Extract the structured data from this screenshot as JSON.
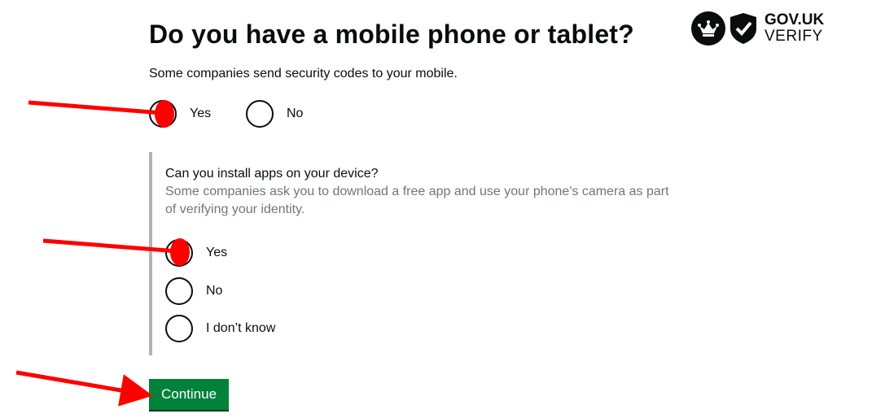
{
  "header": {
    "title": "Do you have a mobile phone or tablet?",
    "logo": {
      "brand": "GOV.UK",
      "product": "VERIFY",
      "icons": [
        "crown-icon",
        "shield-check-icon"
      ]
    }
  },
  "question1": {
    "hint": "Some companies send security codes to your mobile.",
    "options": [
      {
        "label": "Yes",
        "selected": true
      },
      {
        "label": "No",
        "selected": false
      }
    ]
  },
  "question2": {
    "title": "Can you install apps on your device?",
    "hint": "Some companies ask you to download a free app and use your phone's camera as part of verifying your identity.",
    "options": [
      {
        "label": "Yes",
        "selected": true
      },
      {
        "label": "No",
        "selected": false
      },
      {
        "label": "I don’t know",
        "selected": false
      }
    ]
  },
  "actions": {
    "continue_label": "Continue"
  },
  "colors": {
    "continue_button": "#00823b",
    "annotation_arrow": "#ff0000",
    "inset_border": "#b1b4b6",
    "hint_text": "#6f777b"
  }
}
